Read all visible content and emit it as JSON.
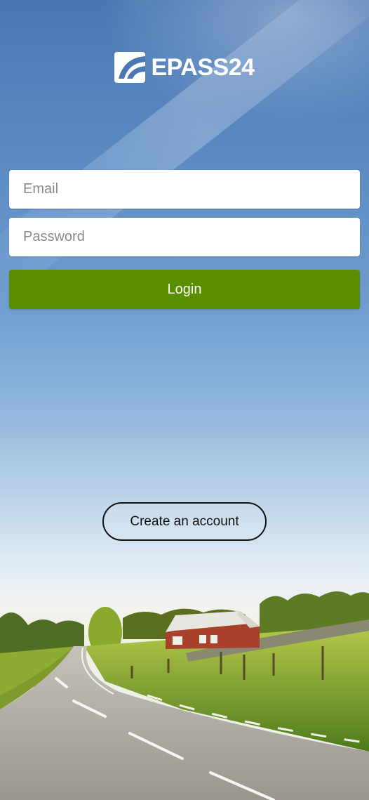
{
  "app": {
    "logo_text": "EPASS24",
    "logo_icon": "epass-logo-icon"
  },
  "login_form": {
    "email_placeholder": "Email",
    "email_value": "",
    "password_placeholder": "Password",
    "password_value": "",
    "login_label": "Login",
    "login_color": "#588e00"
  },
  "footer": {
    "create_account_label": "Create an account"
  },
  "background": {
    "image": "sky-road-farmhouse-landscape"
  }
}
